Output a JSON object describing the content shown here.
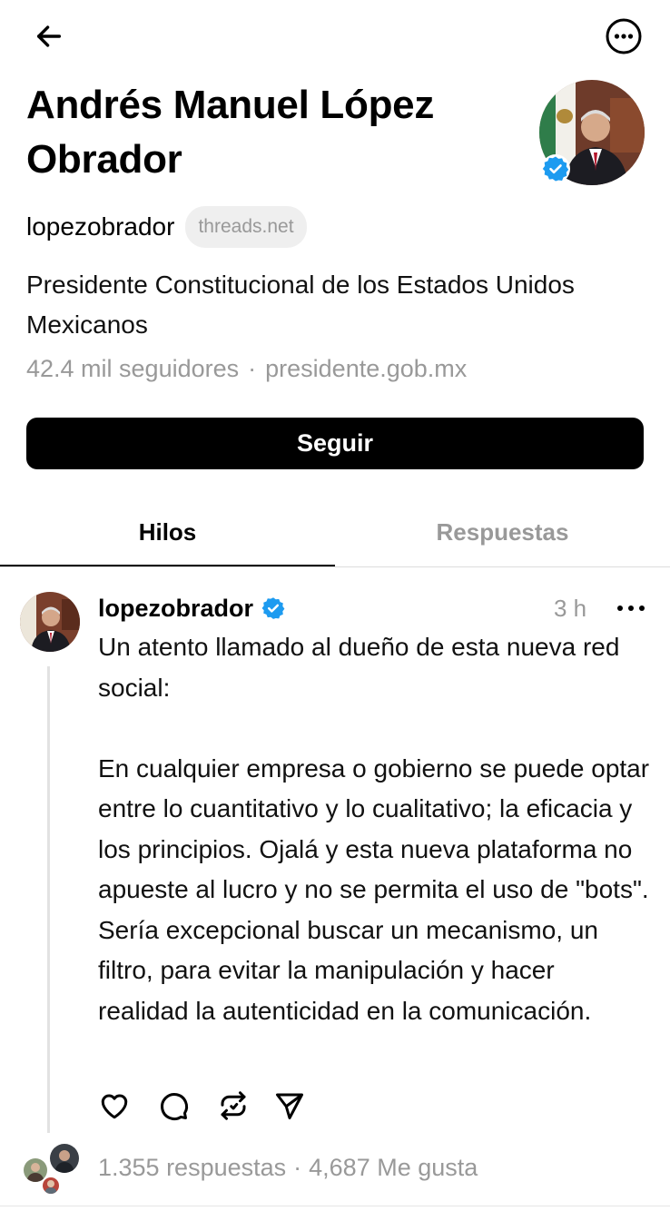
{
  "profile": {
    "name": "Andrés Manuel López Obrador",
    "handle": "lopezobrador",
    "domain": "threads.net",
    "bio": "Presidente Constitucional de los Estados Unidos Mexicanos",
    "followers": "42.4 mil seguidores",
    "separator": "·",
    "website": "presidente.gob.mx",
    "follow_label": "Seguir",
    "verified": true
  },
  "tabs": [
    {
      "label": "Hilos",
      "active": true
    },
    {
      "label": "Respuestas",
      "active": false
    }
  ],
  "post": {
    "author": "lopezobrador",
    "verified": true,
    "time": "3 h",
    "text": "Un atento llamado al dueño de esta nueva red social:\n\nEn cualquier empresa o gobierno se puede optar entre lo cuantitativo y lo cualitativo; la eficacia y los principios. Ojalá y esta nueva plataforma no apueste al lucro y no se permita el uso de \"bots\". Sería excepcional buscar un mecanismo, un filtro, para evitar la manipulación y hacer realidad la autenticidad en la comunicación.",
    "replies": "1.355 respuestas",
    "likes": "4,687 Me gusta",
    "separator": "·"
  },
  "icons": {
    "back": "arrow-left-icon",
    "more": "more-circle-icon",
    "verified": "verified-badge-icon",
    "like": "heart-icon",
    "reply": "comment-icon",
    "repost": "repost-icon",
    "share": "send-icon"
  },
  "colors": {
    "verified": "#1d9bf0",
    "muted": "#999999",
    "chip_bg": "#efefef",
    "button_bg": "#000000"
  }
}
